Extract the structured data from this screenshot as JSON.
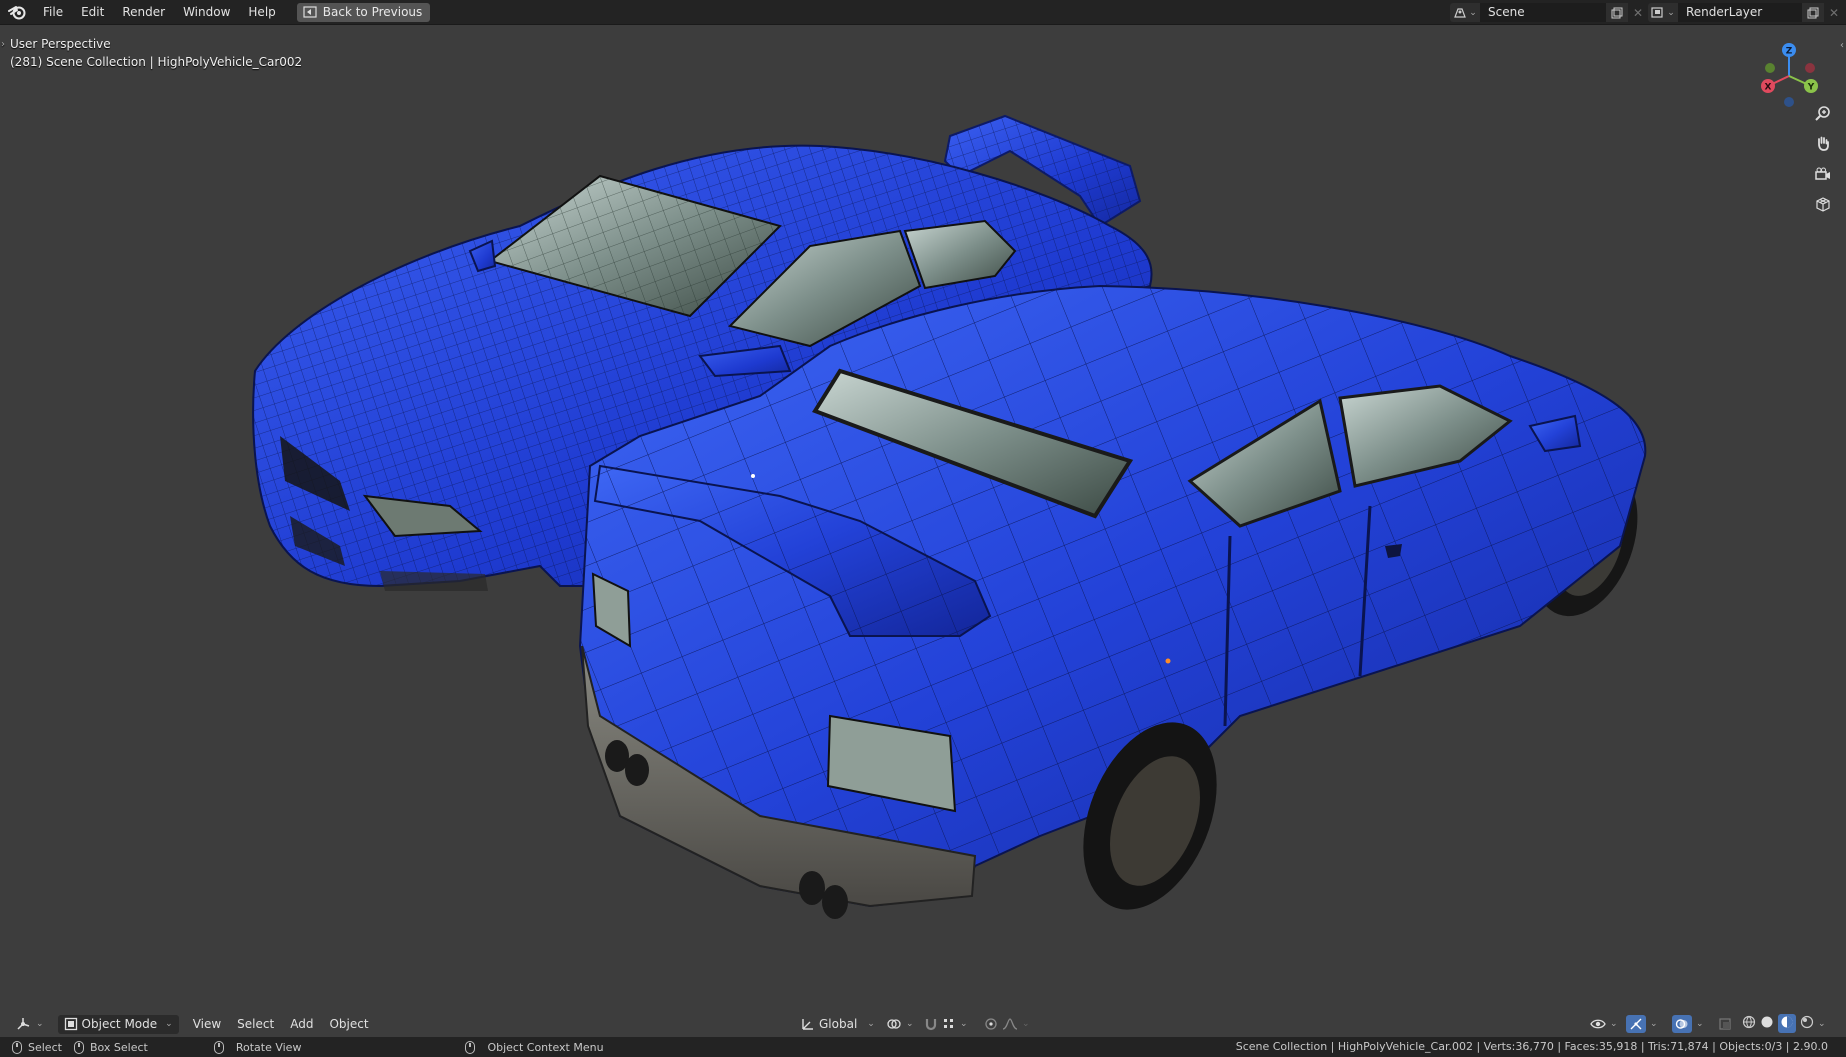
{
  "topbar": {
    "menus": [
      "File",
      "Edit",
      "Render",
      "Window",
      "Help"
    ],
    "back_button": "Back to Previous",
    "scene": "Scene",
    "render_layer": "RenderLayer"
  },
  "viewport": {
    "perspective": "User Perspective",
    "collection": "(281) Scene Collection | HighPolyVehicle_Car002",
    "gizmo_axes": {
      "x": "X",
      "y": "Y",
      "z": "Z"
    }
  },
  "header": {
    "mode": "Object Mode",
    "menus": [
      "View",
      "Select",
      "Add",
      "Object"
    ],
    "orientation": "Global"
  },
  "statusbar": {
    "select": "Select",
    "box_select": "Box Select",
    "rotate_view": "Rotate View",
    "context_menu": "Object Context Menu",
    "stats": "Scene Collection | HighPolyVehicle_Car.002 | Verts:36,770 | Faces:35,918 | Tris:71,874 | Objects:0/3 | 2.90.0"
  },
  "colors": {
    "car_body": "#1f3fd6",
    "viewport_bg": "#3d3d3d",
    "axis_x": "#e04a5e",
    "axis_y": "#8bc34a",
    "axis_z": "#3b8df0"
  }
}
